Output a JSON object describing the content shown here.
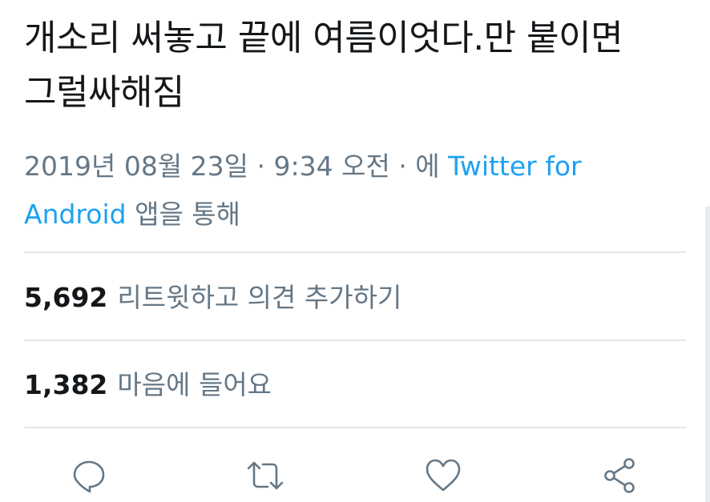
{
  "tweet": {
    "text": "개소리 써놓고 끝에 여름이엇다.만 붙이면 그럴싸해짐",
    "timestamp": "2019년 08월 23일 · 9:34 오전 · 에",
    "source_link": "Twitter for Android",
    "source_suffix": "앱을 통해"
  },
  "stats": {
    "retweets": {
      "count": "5,692",
      "label": "리트윗하고 의견 추가하기"
    },
    "likes": {
      "count": "1,382",
      "label": "마음에 들어요"
    }
  },
  "actions": [
    {
      "icon": "reply-icon"
    },
    {
      "icon": "retweet-icon"
    },
    {
      "icon": "like-heart-icon"
    },
    {
      "icon": "share-icon"
    }
  ],
  "colors": {
    "text": "#14171a",
    "secondary": "#657786",
    "link": "#1da1f2",
    "divider": "#e1e8ed"
  }
}
